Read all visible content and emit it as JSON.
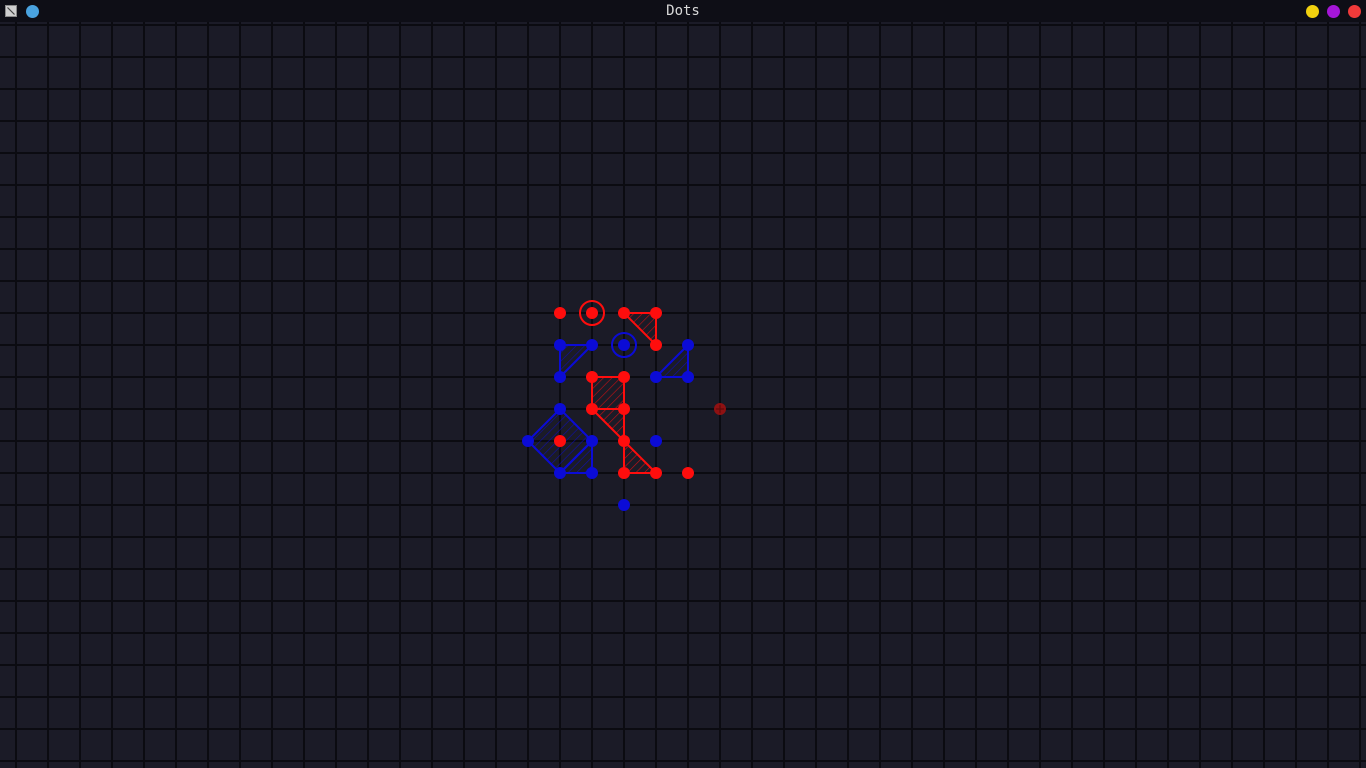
{
  "window": {
    "title": "Dots",
    "titlebar_color": "#0e0e16",
    "left_indicator_color": "#4aa3e0",
    "buttons": [
      {
        "name": "minimize",
        "color": "#f2d10f"
      },
      {
        "name": "maximize",
        "color": "#a516d8"
      },
      {
        "name": "close",
        "color": "#f03a3a"
      }
    ]
  },
  "game": {
    "background": "#1b1b27",
    "grid_color": "#0b0b11",
    "colors": {
      "red": "#ff0d0d",
      "blue": "#0b0bd6",
      "ghost": "#a30f0f"
    },
    "red_dots": [
      [
        17,
        9
      ],
      [
        19,
        9
      ],
      [
        20,
        9
      ],
      [
        20,
        10
      ],
      [
        18,
        11
      ],
      [
        19,
        11
      ],
      [
        18,
        12
      ],
      [
        19,
        12
      ],
      [
        19,
        13
      ],
      [
        19,
        14
      ],
      [
        20,
        14
      ],
      [
        21,
        14
      ],
      [
        17,
        13
      ]
    ],
    "blue_dots": [
      [
        17,
        10
      ],
      [
        18,
        10
      ],
      [
        19,
        10
      ],
      [
        21,
        10
      ],
      [
        17,
        11
      ],
      [
        20,
        11
      ],
      [
        21,
        11
      ],
      [
        17,
        12
      ],
      [
        16,
        13
      ],
      [
        18,
        13
      ],
      [
        20,
        13
      ],
      [
        17,
        14
      ],
      [
        18,
        14
      ],
      [
        19,
        15
      ]
    ],
    "red_polygons": [
      [
        [
          19,
          9
        ],
        [
          20,
          9
        ],
        [
          20,
          10
        ]
      ],
      [
        [
          18,
          11
        ],
        [
          19,
          11
        ],
        [
          19,
          12
        ],
        [
          18,
          12
        ]
      ],
      [
        [
          18,
          12
        ],
        [
          19,
          12
        ],
        [
          19,
          13
        ]
      ],
      [
        [
          19,
          13
        ],
        [
          20,
          14
        ],
        [
          19,
          14
        ]
      ]
    ],
    "blue_polygons": [
      [
        [
          17,
          10
        ],
        [
          18,
          10
        ],
        [
          17,
          11
        ]
      ],
      [
        [
          21,
          10
        ],
        [
          21,
          11
        ],
        [
          20,
          11
        ]
      ],
      [
        [
          17,
          12
        ],
        [
          18,
          13
        ],
        [
          17,
          14
        ],
        [
          16,
          13
        ]
      ],
      [
        [
          18,
          13
        ],
        [
          18,
          14
        ],
        [
          17,
          14
        ]
      ]
    ],
    "last_move_red": [
      18,
      9
    ],
    "last_move_blue": [
      19,
      10
    ],
    "ghost_dot": [
      22,
      12
    ]
  }
}
